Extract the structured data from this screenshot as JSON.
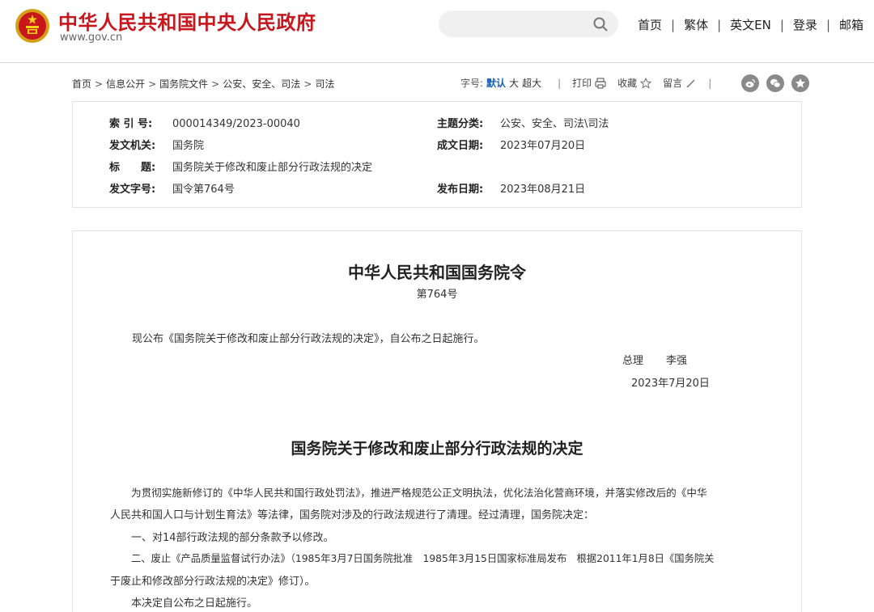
{
  "header": {
    "site_title": "中华人民共和国中央人民政府",
    "site_url": "www.gov.cn",
    "nav": [
      "首页",
      "繁体",
      "英文EN",
      "登录",
      "邮箱"
    ],
    "search_placeholder": ""
  },
  "breadcrumb": [
    "首页",
    "信息公开",
    "国务院文件",
    "公安、安全、司法",
    "司法"
  ],
  "tools": {
    "font_size_label": "字号:",
    "font_sizes": [
      "默认",
      "大",
      "超大"
    ],
    "print_label": "打印",
    "favorite_label": "收藏",
    "comment_label": "留言"
  },
  "info": {
    "index_label": "索 引 号:",
    "index_value": "000014349/2023-00040",
    "topic_label": "主题分类:",
    "topic_value": "公安、安全、司法\\司法",
    "issuer_label": "发文机关:",
    "issuer_value": "国务院",
    "written_label": "成文日期:",
    "written_value": "2023年07月20日",
    "title_label": "标　　题:",
    "title_value": "国务院关于修改和废止部分行政法规的决定",
    "docno_label": "发文字号:",
    "docno_value": "国令第764号",
    "published_label": "发布日期:",
    "published_value": "2023年08月21日"
  },
  "document": {
    "title": "中华人民共和国国务院令",
    "number": "第764号",
    "promulgation": "现公布《国务院关于修改和废止部分行政法规的决定》，自公布之日起施行。",
    "signer_role": "总理",
    "signer_name": "李强",
    "sign_date": "2023年7月20日",
    "decision_title": "国务院关于修改和废止部分行政法规的决定",
    "para1_line1": "为贯彻实施新修订的《中华人民共和国行政处罚法》，推进严格规范公正文明执法，优化法治化营商环境，并落实修改后的《中华",
    "para1_line2": "人民共和国人口与计划生育法》等法律，国务院对涉及的行政法规进行了清理。经过清理，国务院决定：",
    "item1": "一、对14部行政法规的部分条款予以修改。",
    "item2_line1": "二、废止《产品质量监督试行办法》（1985年3月7日国务院批准　1985年3月15日国家标准局发布　根据2011年1月8日《国务院关",
    "item2_line2": "于废止和修改部分行政法规的决定》修订）。",
    "item3": "本决定自公布之日起施行。"
  }
}
